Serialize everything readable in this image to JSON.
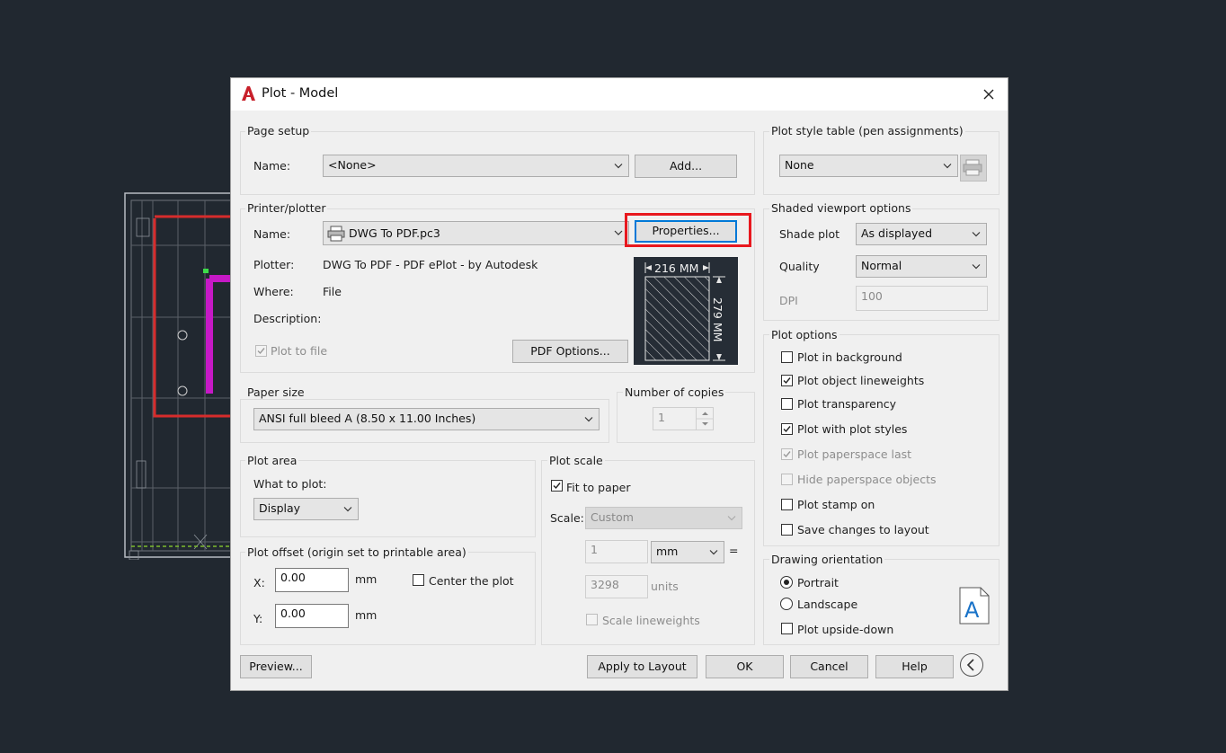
{
  "window": {
    "title": "Plot - Model"
  },
  "page_setup": {
    "group_label": "Page setup",
    "name_label": "Name:",
    "name_value": "<None>",
    "add_button": "Add..."
  },
  "printer": {
    "group_label": "Printer/plotter",
    "name_label": "Name:",
    "name_value": "DWG To PDF.pc3",
    "properties_button": "Properties...",
    "plotter_label": "Plotter:",
    "plotter_value": "DWG To PDF - PDF ePlot - by Autodesk",
    "where_label": "Where:",
    "where_value": "File",
    "description_label": "Description:",
    "plot_to_file_label": "Plot to file",
    "pdf_options_button": "PDF Options...",
    "preview_width": "216  MM",
    "preview_height": "279  MM"
  },
  "paper_size": {
    "group_label": "Paper size",
    "value": "ANSI full bleed A (8.50 x 11.00 Inches)"
  },
  "copies": {
    "group_label": "Number of copies",
    "value": "1"
  },
  "plot_area": {
    "group_label": "Plot area",
    "what_label": "What to plot:",
    "what_value": "Display"
  },
  "plot_offset": {
    "group_label": "Plot offset (origin set to printable area)",
    "x_label": "X:",
    "x_value": "0.00",
    "y_label": "Y:",
    "y_value": "0.00",
    "unit": "mm",
    "center_label": "Center the plot"
  },
  "plot_scale": {
    "group_label": "Plot scale",
    "fit_label": "Fit to paper",
    "scale_label": "Scale:",
    "scale_value": "Custom",
    "value1": "1",
    "unit_value": "mm",
    "equals": "=",
    "value2": "3298",
    "units_label": "units",
    "lineweights_label": "Scale lineweights"
  },
  "plot_style": {
    "group_label": "Plot style table (pen assignments)",
    "value": "None"
  },
  "shaded": {
    "group_label": "Shaded viewport options",
    "shade_label": "Shade plot",
    "shade_value": "As displayed",
    "quality_label": "Quality",
    "quality_value": "Normal",
    "dpi_label": "DPI",
    "dpi_value": "100"
  },
  "plot_options": {
    "group_label": "Plot options",
    "items": [
      {
        "label": "Plot in background",
        "checked": false,
        "disabled": false
      },
      {
        "label": "Plot object lineweights",
        "checked": true,
        "disabled": false
      },
      {
        "label": "Plot transparency",
        "checked": false,
        "disabled": false
      },
      {
        "label": "Plot with plot styles",
        "checked": true,
        "disabled": false
      },
      {
        "label": "Plot paperspace last",
        "checked": true,
        "disabled": true
      },
      {
        "label": "Hide paperspace objects",
        "checked": false,
        "disabled": true
      },
      {
        "label": "Plot stamp on",
        "checked": false,
        "disabled": false
      },
      {
        "label": "Save changes to layout",
        "checked": false,
        "disabled": false
      }
    ]
  },
  "orientation": {
    "group_label": "Drawing orientation",
    "portrait": "Portrait",
    "landscape": "Landscape",
    "upside_down": "Plot upside-down",
    "selected": "portrait"
  },
  "footer": {
    "preview": "Preview...",
    "apply": "Apply to Layout",
    "ok": "OK",
    "cancel": "Cancel",
    "help": "Help"
  },
  "colors": {
    "background": "#212830",
    "highlight": "#e8181e",
    "accent_blue": "#1a73c8"
  }
}
